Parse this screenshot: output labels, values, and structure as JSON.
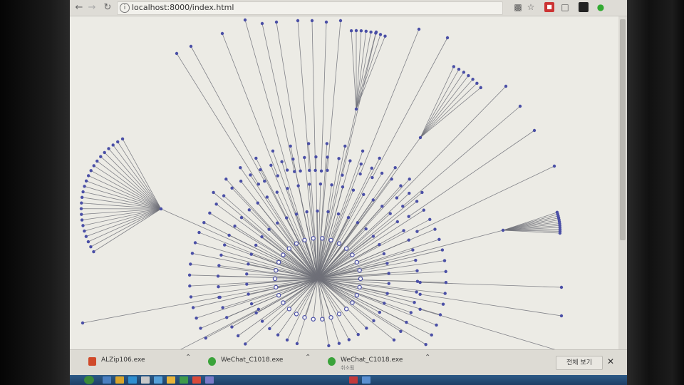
{
  "browser": {
    "url": "localhost:8000/index.html",
    "back_icon": "arrow-left-icon",
    "forward_icon": "arrow-right-icon",
    "reload_icon": "reload-icon",
    "info_icon": "info-icon",
    "translate_icon": "translate-icon",
    "star_icon": "star-icon"
  },
  "graph": {
    "type": "radial-network",
    "node_color": "#4a4fa6",
    "edge_color": "#6e7078",
    "center_node_color": "#f4f4f8"
  },
  "downloads": {
    "items": [
      {
        "name": "ALZip106.exe",
        "sub": ""
      },
      {
        "name": "WeChat_C1018.exe",
        "sub": ""
      },
      {
        "name": "WeChat_C1018.exe",
        "sub": "취소됨"
      }
    ],
    "show_all_label": "전체 보기",
    "close_icon": "close-icon"
  }
}
